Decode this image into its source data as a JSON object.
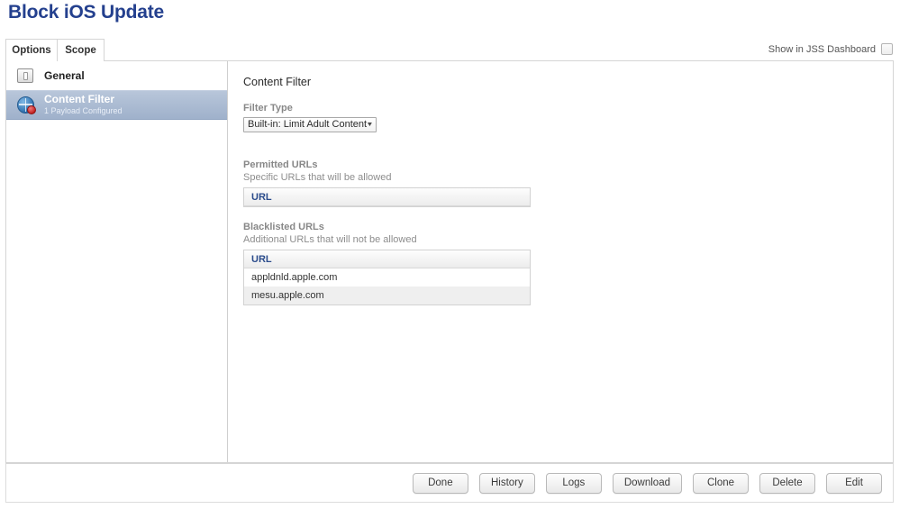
{
  "page": {
    "title": "Block iOS Update"
  },
  "tabs": [
    {
      "label": "Options",
      "active": true
    },
    {
      "label": "Scope",
      "active": false
    }
  ],
  "dashboard_toggle": {
    "label": "Show in JSS Dashboard",
    "checked": false
  },
  "sidebar": {
    "items": [
      {
        "label": "General",
        "sub": "",
        "icon": "device-icon",
        "selected": false
      },
      {
        "label": "Content Filter",
        "sub": "1 Payload Configured",
        "icon": "globe-icon",
        "selected": true
      }
    ]
  },
  "main": {
    "heading": "Content Filter",
    "filter_type": {
      "label": "Filter Type",
      "value": "Built-in: Limit Adult Content"
    },
    "permitted": {
      "label": "Permitted URLs",
      "description": "Specific URLs that will be allowed",
      "column_header": "URL",
      "rows": []
    },
    "blacklisted": {
      "label": "Blacklisted URLs",
      "description": "Additional URLs that will not be allowed",
      "column_header": "URL",
      "rows": [
        "appldnld.apple.com",
        "mesu.apple.com"
      ]
    }
  },
  "footer": {
    "buttons": [
      {
        "label": "Done"
      },
      {
        "label": "History"
      },
      {
        "label": "Logs"
      },
      {
        "label": "Download"
      },
      {
        "label": "Clone"
      },
      {
        "label": "Delete"
      },
      {
        "label": "Edit"
      }
    ]
  },
  "colors": {
    "title": "#24408e",
    "selected_row": "#9fb1cb",
    "table_header_text": "#2b4c8c"
  }
}
